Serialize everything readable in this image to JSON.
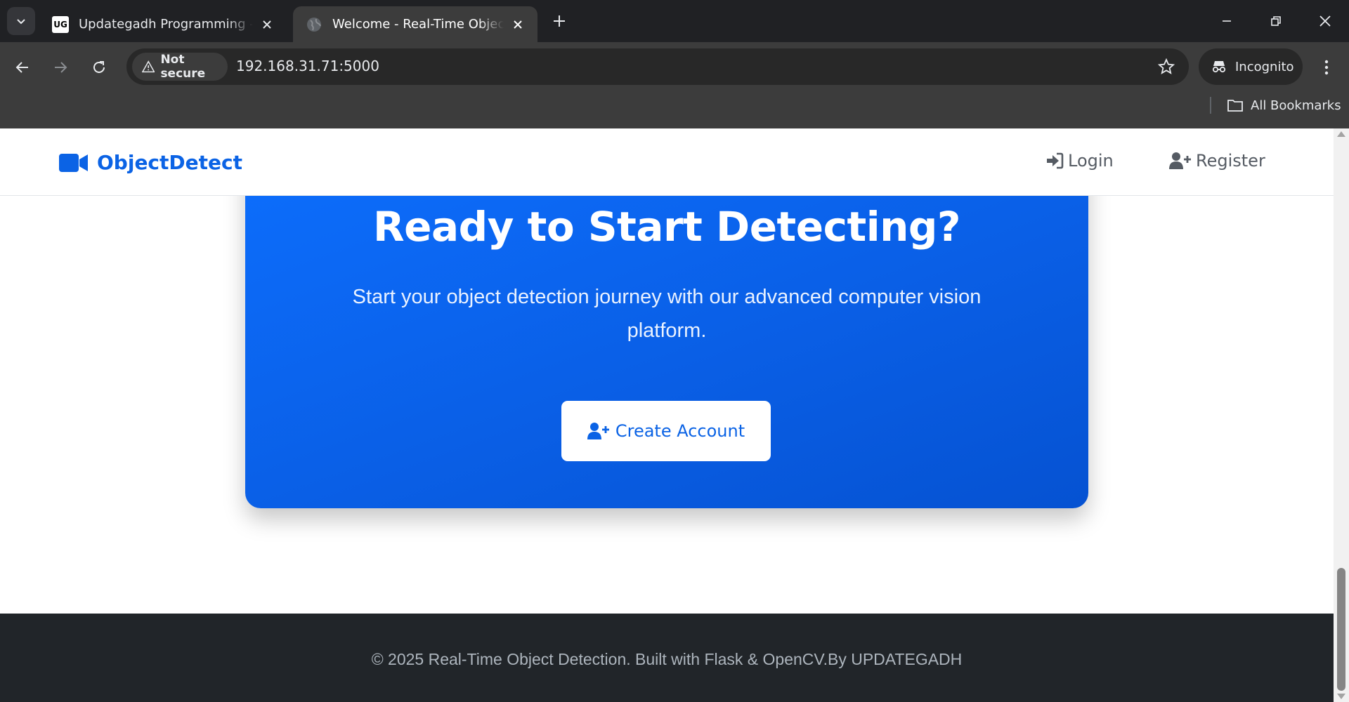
{
  "browser": {
    "tabs": [
      {
        "title": "Updategadh Programming - Updategadh",
        "favicon": "ug-logo-icon",
        "active": false
      },
      {
        "title": "Welcome - Real-Time Object Detection",
        "favicon": "globe-icon",
        "active": true
      }
    ],
    "security_label": "Not secure",
    "url": "192.168.31.71:5000",
    "profile_label": "Incognito",
    "bookmarks_label": "All Bookmarks"
  },
  "site": {
    "brand": "ObjectDetect",
    "nav": {
      "login": "Login",
      "register": "Register"
    }
  },
  "cta": {
    "title": "Ready to Start Detecting?",
    "text": "Start your object detection journey with our advanced computer vision platform.",
    "button": "Create Account"
  },
  "footer": {
    "text": "© 2025 Real-Time Object Detection. Built with Flask & OpenCV.By UPDATEGADH"
  },
  "colors": {
    "primary": "#0d6efd",
    "footer_bg": "#212529",
    "nav_text": "#555b63"
  }
}
